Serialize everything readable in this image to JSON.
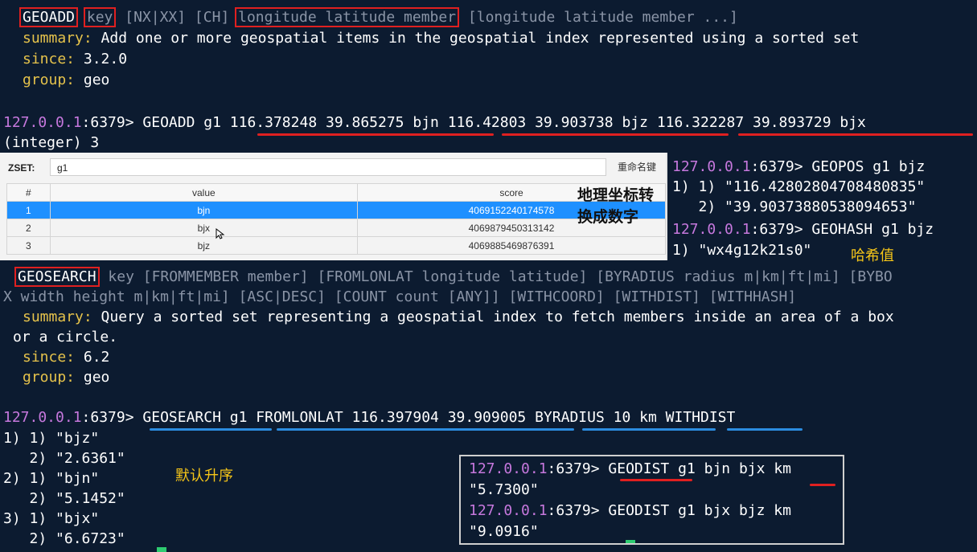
{
  "geoadd_help": {
    "command": "GEOADD",
    "key": "key",
    "options": "[NX|XX] [CH]",
    "args": "longitude latitude member",
    "args_more": "[longitude latitude member ...]",
    "summary_label": "summary:",
    "summary": "Add one or more geospatial items in the geospatial index represented using a sorted set",
    "since_label": "since:",
    "since": "3.2.0",
    "group_label": "group:",
    "group": "geo"
  },
  "prompt": {
    "host": "127.0.0.1",
    "rest": ":6379> "
  },
  "geoadd_cmd": {
    "cmd": "GEOADD g1 ",
    "item1": "116.378248 39.865275 bjn",
    "item2": "116.42803 39.903738 bjz",
    "item3": "116.322287 39.893729 bjx",
    "result": "(integer) 3"
  },
  "zset_panel": {
    "label": "ZSET:",
    "name": "g1",
    "rename_button": "重命名键",
    "columns": [
      "#",
      "value",
      "score"
    ],
    "rows": [
      {
        "n": "1",
        "value": "bjn",
        "score": "4069152240174578"
      },
      {
        "n": "2",
        "value": "bjx",
        "score": "4069879450313142"
      },
      {
        "n": "3",
        "value": "bjz",
        "score": "4069885469876391"
      }
    ],
    "note": "地理坐标转换成数字"
  },
  "right_terminal": {
    "geopos_cmd": "GEOPOS g1 bjz",
    "geopos_r1": "1) 1) \"116.42802804708480835\"",
    "geopos_r2": "   2) \"39.90373880538094653\"",
    "geohash_cmd": "GEOHASH g1 bjz",
    "geohash_r1": "1) \"wx4g12k21s0\"",
    "geohash_note": "哈希值"
  },
  "geosearch_help": {
    "command": "GEOSEARCH",
    "line1_rest": "key [FROMMEMBER member] [FROMLONLAT longitude latitude] [BYRADIUS radius m|km|ft|mi] [BYBO",
    "line2": "X width height m|km|ft|mi] [ASC|DESC] [COUNT count [ANY]] [WITHCOORD] [WITHDIST] [WITHHASH]",
    "summary_label": "summary:",
    "summary1": "Query a sorted set representing a geospatial index to fetch members inside an area of a box",
    "summary2": "or a circle.",
    "since_label": "since:",
    "since": "6.2",
    "group_label": "group:",
    "group": "geo"
  },
  "geosearch_cmd": {
    "p1": "GEOSEARCH g1",
    "p2": "FROMLONLAT 116.397904 39.909005",
    "p3": "BYRADIUS 10 km",
    "p4": "WITHDIST",
    "results": [
      "1) 1) \"bjz\"",
      "   2) \"2.6361\"",
      "2) 1) \"bjn\"",
      "   2) \"5.1452\"",
      "3) 1) \"bjx\"",
      "   2) \"6.6723\""
    ],
    "note": "默认升序"
  },
  "geodist": {
    "cmd1_name": "GEODIST",
    "cmd1_args": "g1 bjn bjx",
    "cmd1_unit": "km",
    "result1": "\"5.7300\"",
    "cmd2": "GEODIST g1 bjx bjz km",
    "result2": "\"9.0916\""
  },
  "colors": {
    "background": "#0c1b30",
    "help_keyword": "#e5c24b",
    "prompt_host": "#c678dd",
    "highlight_box": "#e02020",
    "underline_blue": "#2c8ce0",
    "selected_row": "#1e90ff"
  }
}
